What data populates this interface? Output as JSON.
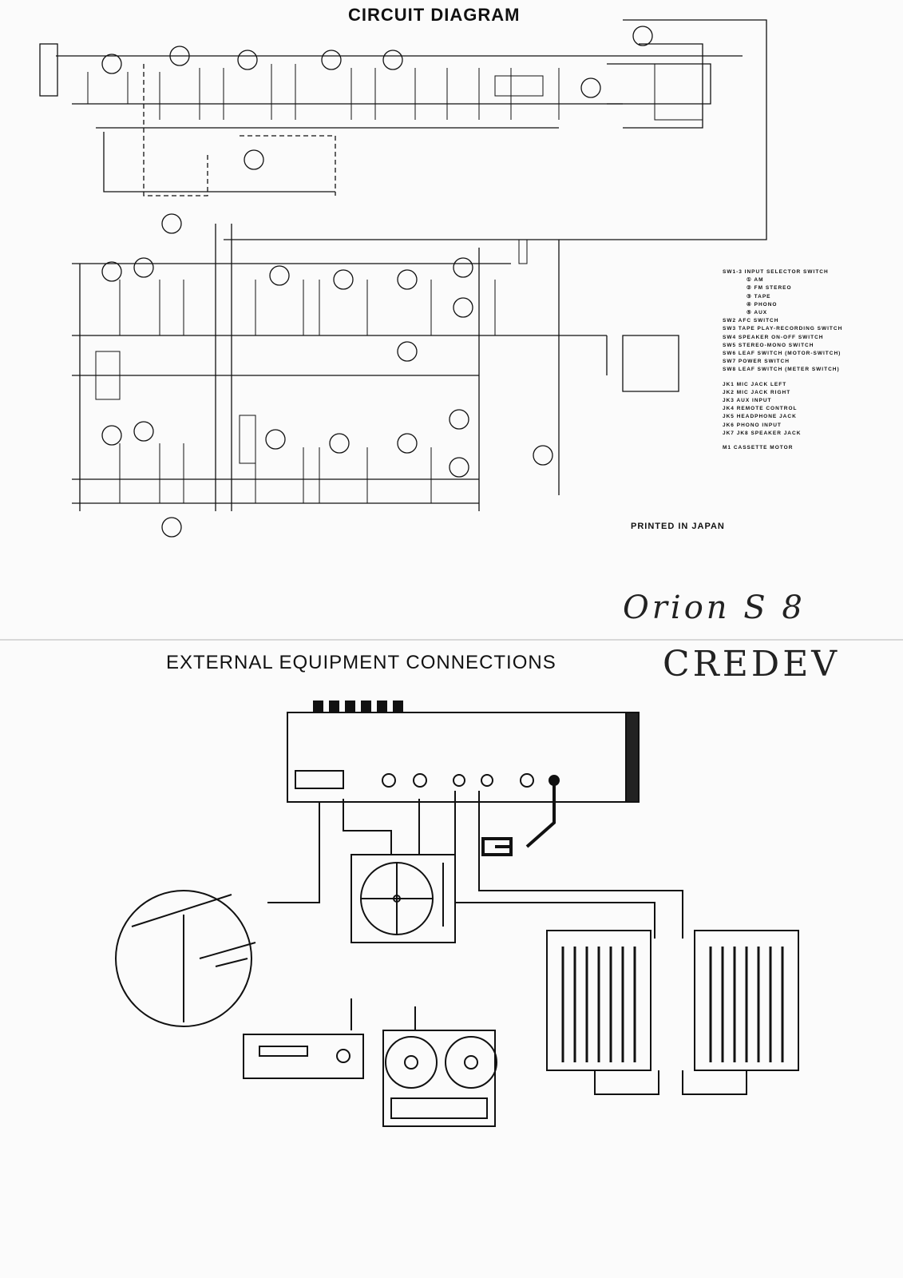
{
  "circuit": {
    "title": "CIRCUIT DIAGRAM",
    "legend": [
      "SW1-3  INPUT SELECTOR SWITCH",
      "① AM",
      "② FM STEREO",
      "③ TAPE",
      "④ PHONO",
      "⑤ AUX",
      "SW2  AFC SWITCH",
      "SW3  TAPE PLAY-RECORDING SWITCH",
      "SW4  SPEAKER ON-OFF SWITCH",
      "SW5  STEREO-MONO SWITCH",
      "SW6  LEAF SWITCH (MOTOR-SWITCH)",
      "SW7  POWER SWITCH",
      "SW8  LEAF SWITCH (METER SWITCH)",
      "JK1  MIC JACK LEFT",
      "JK2  MIC JACK RIGHT",
      "JK3  AUX INPUT",
      "JK4  REMOTE CONTROL",
      "JK5  HEADPHONE JACK",
      "JK6  PHONO INPUT",
      "JK7  JK8  SPEAKER JACK",
      "M1  CASSETTE MOTOR"
    ],
    "printed": "PRINTED IN JAPAN"
  },
  "handwriting": {
    "line1": "Orion S 8",
    "line2": "CREDEV"
  },
  "external": {
    "title": "EXTERNAL EQUIPMENT CONNECTIONS"
  }
}
